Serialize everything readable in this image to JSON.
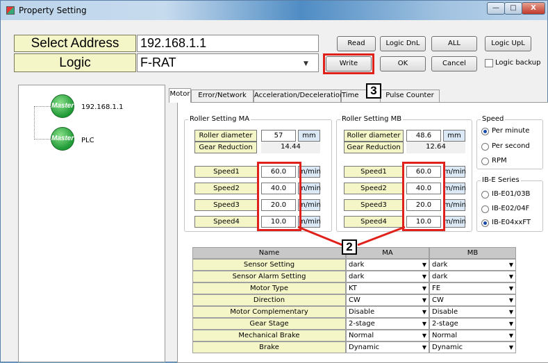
{
  "window": {
    "title": "Property Setting",
    "min": "—",
    "max": "□",
    "close": "X"
  },
  "top": {
    "select_address_label": "Select Address",
    "address_value": "192.168.1.1",
    "logic_label": "Logic",
    "logic_value": "F-RAT",
    "dropdown_arrow": "▼",
    "buttons": {
      "read": "Read",
      "logic_dnl": "Logic DnL",
      "all": "ALL",
      "logic_upl": "Logic UpL",
      "write": "Write",
      "ok": "OK",
      "cancel": "Cancel"
    },
    "logic_backup_label": "Logic backup"
  },
  "callouts": {
    "c2": "2",
    "c3": "3"
  },
  "tree": {
    "items": [
      {
        "icon_text": "Master",
        "label": "192.168.1.1"
      },
      {
        "icon_text": "Master",
        "label": "PLC"
      }
    ]
  },
  "tabs": [
    "Motor",
    "Error/Network",
    "Acceleration/Deceleration",
    "Time",
    "ter",
    "Pulse Counter"
  ],
  "motor": {
    "ma": {
      "title": "Roller Setting MA",
      "roller_label": "Roller diameter",
      "roller_value": "57",
      "roller_unit": "mm",
      "gear_label": "Gear Reduction",
      "gear_value": "14.44",
      "speeds": [
        {
          "label": "Speed1",
          "value": "60.0",
          "unit": "m/min"
        },
        {
          "label": "Speed2",
          "value": "40.0",
          "unit": "m/min"
        },
        {
          "label": "Speed3",
          "value": "20.0",
          "unit": "m/min"
        },
        {
          "label": "Speed4",
          "value": "10.0",
          "unit": "m/min"
        }
      ]
    },
    "mb": {
      "title": "Roller Setting MB",
      "roller_label": "Roller diameter",
      "roller_value": "48.6",
      "roller_unit": "mm",
      "gear_label": "Gear Reduction",
      "gear_value": "12.64",
      "speeds": [
        {
          "label": "Speed1",
          "value": "60.0",
          "unit": "m/min"
        },
        {
          "label": "Speed2",
          "value": "40.0",
          "unit": "m/min"
        },
        {
          "label": "Speed3",
          "value": "20.0",
          "unit": "m/min"
        },
        {
          "label": "Speed4",
          "value": "10.0",
          "unit": "m/min"
        }
      ]
    },
    "speed_group": {
      "title": "Speed",
      "options": [
        "Per minute",
        "Per second",
        "RPM"
      ],
      "selected": "Per minute"
    },
    "ibe_group": {
      "title": "IB-E Series",
      "options": [
        "IB-E01/03B",
        "IB-E02/04F",
        "IB-E04xxFT"
      ],
      "selected": "IB-E04xxFT"
    }
  },
  "grid": {
    "headers": {
      "name": "Name",
      "ma": "MA",
      "mb": "MB"
    },
    "rows": [
      {
        "name": "Sensor Setting",
        "ma": "dark",
        "mb": "dark"
      },
      {
        "name": "Sensor Alarm Setting",
        "ma": "dark",
        "mb": "dark"
      },
      {
        "name": "Motor Type",
        "ma": "KT",
        "mb": "FE"
      },
      {
        "name": "Direction",
        "ma": "CW",
        "mb": "CW"
      },
      {
        "name": "Motor Complementary",
        "ma": "Disable",
        "mb": "Disable"
      },
      {
        "name": "Gear Stage",
        "ma": "2-stage",
        "mb": "2-stage"
      },
      {
        "name": "Mechanical Brake",
        "ma": "Normal",
        "mb": "Normal"
      },
      {
        "name": "Brake",
        "ma": "Dynamic",
        "mb": "Dynamic"
      }
    ]
  }
}
